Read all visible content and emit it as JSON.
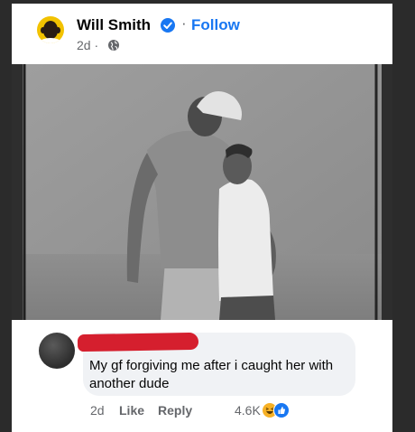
{
  "post": {
    "author": "Will Smith",
    "follow_label": "Follow",
    "separator": "·",
    "timestamp": "2d ·",
    "privacy_icon": "globe-icon",
    "verified_icon": "verified-badge-icon"
  },
  "comment": {
    "text": "My gf forgiving me after i caught her with another dude",
    "time": "2d",
    "like_label": "Like",
    "reply_label": "Reply",
    "reaction_count": "4.6K",
    "reaction_icons": [
      "haha-emoji-icon",
      "like-reaction-icon"
    ]
  },
  "colors": {
    "brand_blue": "#1877f2",
    "redaction": "#d51f2e",
    "bubble": "#f0f2f5"
  }
}
